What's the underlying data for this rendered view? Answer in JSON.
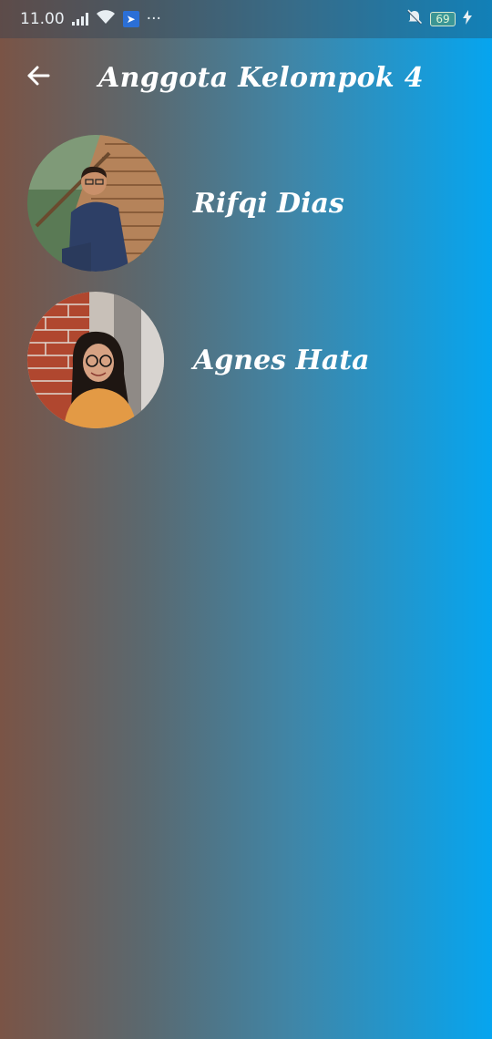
{
  "status_bar": {
    "time": "11.00",
    "more": "···",
    "battery_level": "69",
    "icons": [
      "signal-icon",
      "wifi-icon",
      "runner-icon",
      "mute-bell-icon",
      "battery-icon",
      "charging-icon"
    ]
  },
  "app_bar": {
    "title": "Anggota Kelompok 4",
    "back_icon": "arrow-back-icon"
  },
  "members": [
    {
      "name": "Rifqi Dias",
      "avatar": "photo-man-on-wooden-stairs"
    },
    {
      "name": "Agnes Hata",
      "avatar": "photo-woman-by-brick-wall"
    }
  ],
  "colors": {
    "gradient_left": "#7a5446",
    "gradient_right": "#06a5ef",
    "text": "#ffffff"
  }
}
